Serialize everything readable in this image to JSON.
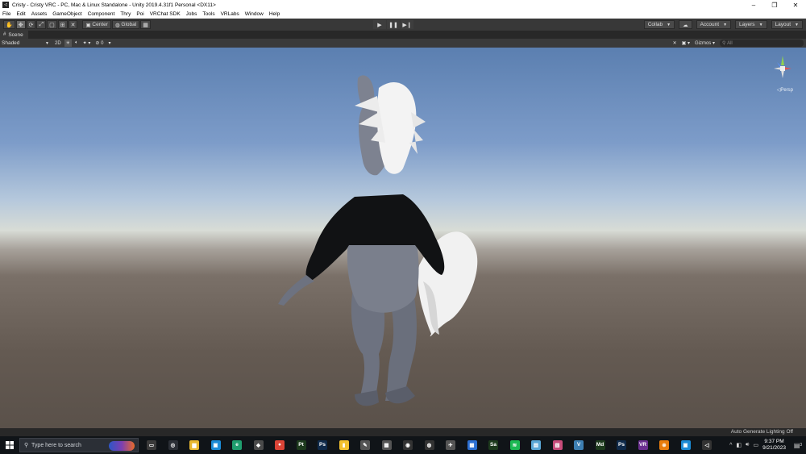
{
  "window": {
    "title": "Cristy - Cristy VRC - PC, Mac & Linux Standalone - Unity 2019.4.31f1 Personal <DX11>",
    "app_icon": "unity-icon",
    "minimize": "–",
    "maximize": "❐",
    "close": "✕"
  },
  "menu": {
    "items": [
      "File",
      "Edit",
      "Assets",
      "GameObject",
      "Component",
      "Thry",
      "Poi",
      "VRChat SDK",
      "Jobs",
      "Tools",
      "VRLabs",
      "Window",
      "Help"
    ]
  },
  "toolbar": {
    "center_label": "Center",
    "global_label": "Global",
    "collab_label": "Collab",
    "account_label": "Account",
    "layers_label": "Layers",
    "layout_label": "Layout"
  },
  "scene_tab": {
    "label": "Scene"
  },
  "scene_toolbar": {
    "draw_mode": "Shaded",
    "mode_2d": "2D",
    "fx_count": "0",
    "gizmos_label": "Gizmos",
    "search_placeholder": "All"
  },
  "viewport": {
    "projection": "◁Persp"
  },
  "status": {
    "text": "Auto Generate Lighting Off"
  },
  "taskbar": {
    "search_placeholder": "Type here to search",
    "time": "9:37 PM",
    "date": "9/21/2023",
    "notification_count": "3",
    "apps": [
      {
        "name": "media-player",
        "glyph": "▭",
        "color": "#3a3a3a"
      },
      {
        "name": "compass-app",
        "glyph": "◎",
        "color": "#2b2f36"
      },
      {
        "name": "file-explorer",
        "glyph": "▆",
        "color": "#e8b830"
      },
      {
        "name": "capture-app",
        "glyph": "▣",
        "color": "#1b8bd6"
      },
      {
        "name": "edge-app",
        "glyph": "e",
        "color": "#1f9e6e"
      },
      {
        "name": "unity-hub",
        "glyph": "◆",
        "color": "#4a4a4a"
      },
      {
        "name": "chrome",
        "glyph": "●",
        "color": "#db4437"
      },
      {
        "name": "substance-painter",
        "glyph": "Pt",
        "color": "#1d3a1d"
      },
      {
        "name": "photoshop-2",
        "glyph": "Ps",
        "color": "#0f2a4a"
      },
      {
        "name": "sticky-notes",
        "glyph": "▮",
        "color": "#f2c12e"
      },
      {
        "name": "pencil-app",
        "glyph": "✎",
        "color": "#555"
      },
      {
        "name": "monitor-app",
        "glyph": "▦",
        "color": "#555"
      },
      {
        "name": "steam-app",
        "glyph": "◉",
        "color": "#333"
      },
      {
        "name": "obs-app",
        "glyph": "◍",
        "color": "#333"
      },
      {
        "name": "blender-like",
        "glyph": "✈",
        "color": "#555"
      },
      {
        "name": "calculator",
        "glyph": "▦",
        "color": "#2c6fd1"
      },
      {
        "name": "substance-designer",
        "glyph": "Sa",
        "color": "#1d3a1d"
      },
      {
        "name": "spotify",
        "glyph": "≋",
        "color": "#1db954"
      },
      {
        "name": "notepad",
        "glyph": "▤",
        "color": "#5aa7d6"
      },
      {
        "name": "image-viewer",
        "glyph": "▧",
        "color": "#c74b7a"
      },
      {
        "name": "visual-studio",
        "glyph": "V",
        "color": "#3d7fb2"
      },
      {
        "name": "markdown-app",
        "glyph": "Md",
        "color": "#1d3a1d"
      },
      {
        "name": "photoshop",
        "glyph": "Ps",
        "color": "#0f2a4a"
      },
      {
        "name": "vrchat-app",
        "glyph": "VR",
        "color": "#6b2f8f"
      },
      {
        "name": "blender",
        "glyph": "⊗",
        "color": "#e87d0d"
      },
      {
        "name": "chat-app",
        "glyph": "▣",
        "color": "#1b8bd6"
      },
      {
        "name": "unity-editor",
        "glyph": "◁",
        "color": "#333"
      }
    ]
  }
}
